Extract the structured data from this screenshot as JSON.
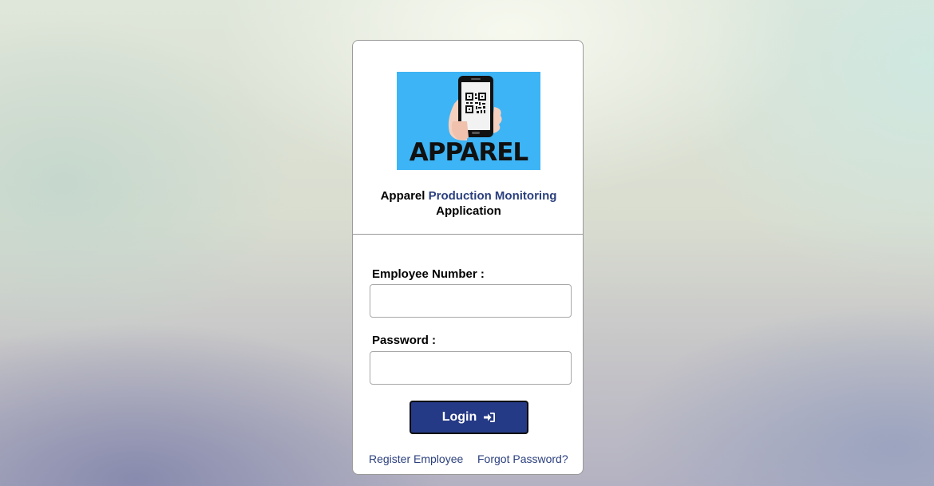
{
  "logo": {
    "word": "APPAREL",
    "icon": "phone-qr-code-icon",
    "background_color": "#3db4f5"
  },
  "app_title": {
    "part1": "Apparel",
    "part2": "Production Monitoring",
    "part3": "Application"
  },
  "form": {
    "employee_number_label": "Employee Number :",
    "employee_number_value": "",
    "password_label": "Password :",
    "password_value": "",
    "login_label": "Login",
    "login_icon": "sign-in-icon"
  },
  "links": {
    "register": "Register Employee",
    "forgot": "Forgot Password?"
  },
  "colors": {
    "accent": "#2a3f7e",
    "button": "#253a86"
  }
}
